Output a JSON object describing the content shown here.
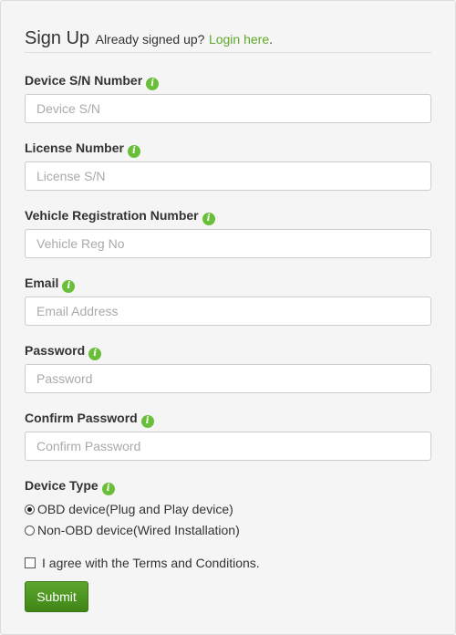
{
  "header": {
    "title": "Sign Up",
    "subtitle": "Already signed up?",
    "login_link": "Login here",
    "login_suffix": "."
  },
  "fields": [
    {
      "label": "Device S/N Number",
      "placeholder": "Device S/N",
      "value": ""
    },
    {
      "label": "License Number",
      "placeholder": "License S/N",
      "value": ""
    },
    {
      "label": "Vehicle Registration Number",
      "placeholder": "Vehicle Reg No",
      "value": ""
    },
    {
      "label": "Email",
      "placeholder": "Email Address",
      "value": ""
    },
    {
      "label": "Password",
      "placeholder": "Password",
      "value": ""
    },
    {
      "label": "Confirm Password",
      "placeholder": "Confirm Password",
      "value": ""
    }
  ],
  "device_type": {
    "label": "Device Type",
    "options": [
      {
        "label": "OBD device(Plug and Play device)",
        "checked": true
      },
      {
        "label": "Non-OBD device(Wired Installation)",
        "checked": false
      }
    ]
  },
  "terms": {
    "label": "I agree with the Terms and Conditions.",
    "checked": false
  },
  "submit_label": "Submit",
  "icons": {
    "info": "info-icon",
    "glyph": "i"
  },
  "colors": {
    "accent": "#5fa82b",
    "button": "#4a9420",
    "info_icon": "#6abf3a"
  }
}
